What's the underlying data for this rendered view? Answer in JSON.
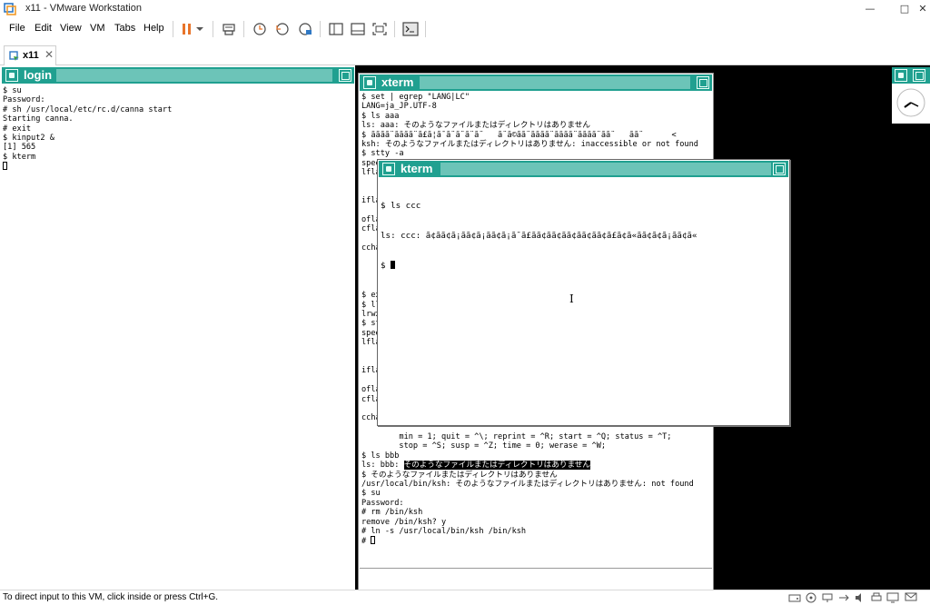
{
  "window": {
    "title": "x11 - VMware Workstation",
    "minimize_glyph": "—",
    "restore_glyph": "□",
    "close_glyph": "✕"
  },
  "menu": [
    "File",
    "Edit",
    "View",
    "VM",
    "Tabs",
    "Help"
  ],
  "toolbar_icons": [
    "pause-icon",
    "dropdown-arrow-icon",
    "send-ctrl-alt-del-icon",
    "snapshot-icon",
    "revert-snapshot-icon",
    "snapshot-manager-icon",
    "show-library-icon",
    "thumbnail-bar-icon",
    "fullscreen-icon",
    "console-view-icon"
  ],
  "tab": {
    "label": "x11",
    "close": "✕"
  },
  "login_window": {
    "title": "login",
    "lines": [
      "$ su",
      "Password:",
      "# sh /usr/local/etc/rc.d/canna start",
      "Starting canna.",
      "# exit",
      "$ kinput2 &",
      "[1] 565",
      "$ kterm"
    ]
  },
  "xterm_window": {
    "title": "xterm",
    "lines": [
      "$ set | egrep \"LANG|LC\"",
      "LANG=ja_JP.UTF-8",
      "$ ls aaa",
      "ls: aaa: そのようなファイルまたはディレクトリはありません",
      "$ ãããã¨ãããã¨ã£ã¦ã¯ã¨ã¨ã¨ã¨   ã¨ã©ãã¨ãããã¨ãããã¨ãããã¨ãã¨   ãã¨      <",
      "ksh: そのようなファイルまたはディレクトリはありません: inaccessible or not found",
      "$ stty -a",
      "spee",
      "lfla",
      "",
      "",
      "ifla",
      "",
      "ofla",
      "cfla",
      "",
      "ccha",
      "",
      "",
      "",
      "",
      "$ ex",
      "$ ll",
      "lrwx",
      "$ st",
      "spee",
      "lfla",
      "",
      "",
      "ifla",
      "",
      "ofla",
      "cfla",
      "",
      "ccha",
      "",
      "        min = 1; quit = ^\\; reprint = ^R; start = ^Q; status = ^T;",
      "        stop = ^S; susp = ^Z; time = 0; werase = ^W;",
      "$ ls bbb"
    ],
    "bbb_prefix": "ls: bbb: ",
    "bbb_highlight": "そのようなファイルまたはディレクトリはありません",
    "lines_after": [
      "$ そのようなファイルまたはディレクトリはありません",
      "/usr/local/bin/ksh: そのようなファイルまたはディレクトリはありません: not found",
      "$ su",
      "Password:",
      "# rm /bin/ksh",
      "remove /bin/ksh? y",
      "# ln -s /usr/local/bin/ksh /bin/ksh",
      "# "
    ]
  },
  "kterm_window": {
    "title": "kterm",
    "lines": [
      "$ ls ccc",
      "ls: ccc: ã¢ãã¢ã¡ãã¢ã¡ãã¢ã¡ã¯ã£ãã¢ãã¢ãã¢ãã¢ãã¢ã£ã¢ã«ãã¢ã¢ã¡ãã¢ã«"
    ],
    "prompt": "$ ",
    "ibeam": "I"
  },
  "statusbar": {
    "message": "To direct input to this VM, click inside or press Ctrl+G.",
    "icons": [
      "hdd-icon",
      "cdrom-icon",
      "network-icon",
      "usb-icon",
      "sound-icon",
      "printer-icon",
      "display-icon",
      "message-icon"
    ]
  },
  "colors": {
    "x_titlebar": "#20a090",
    "x_title_stripe": "#6cc4b8",
    "accent_orange": "#e8742a"
  }
}
